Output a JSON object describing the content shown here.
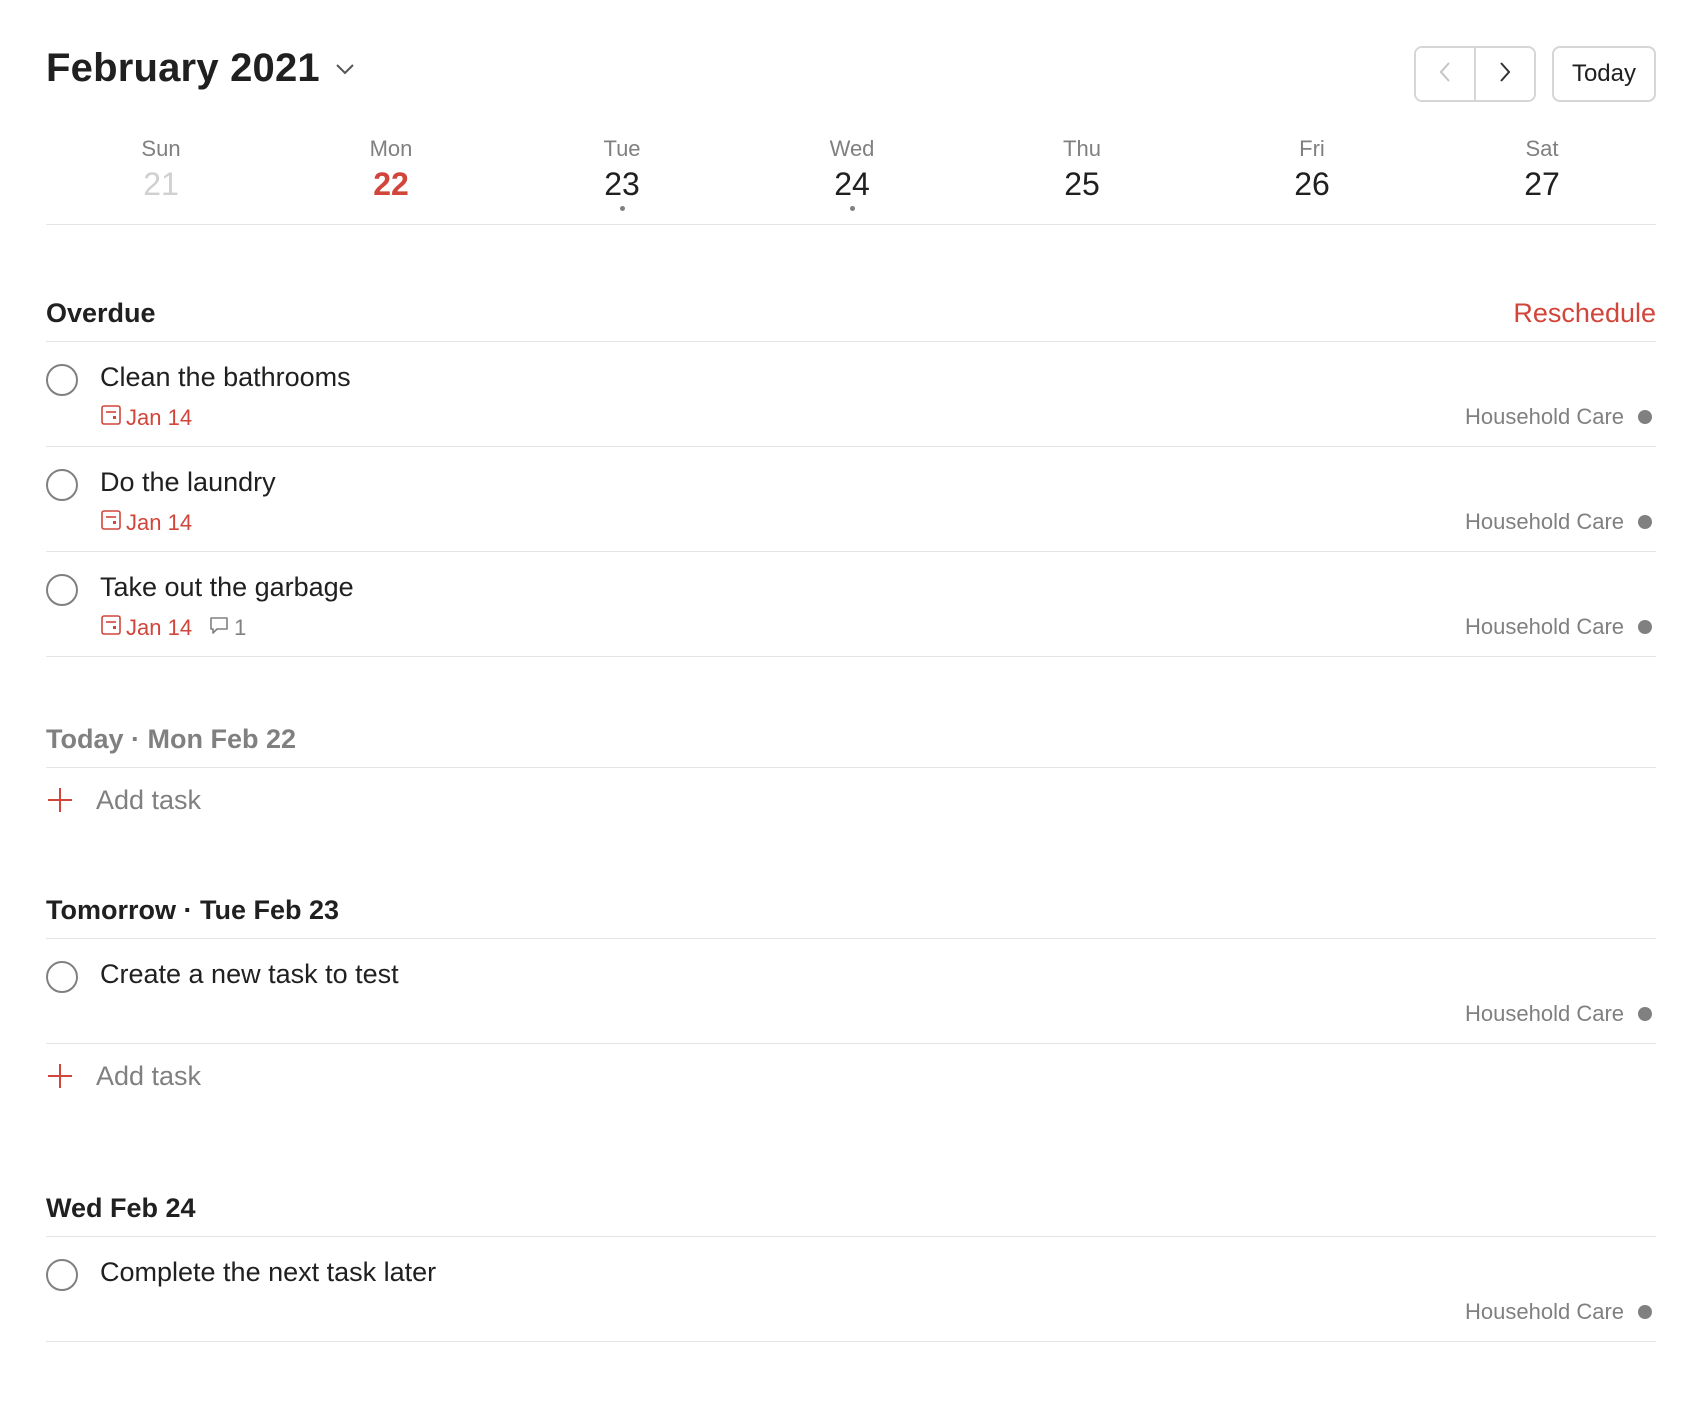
{
  "header": {
    "month_title": "February 2021",
    "prev_icon": "chevron-left-icon",
    "next_icon": "chevron-right-icon",
    "today_label": "Today"
  },
  "colors": {
    "accent": "#d1453b",
    "muted": "#808080",
    "text": "#202020",
    "divider": "#e4e4e4"
  },
  "week": [
    {
      "name": "Sun",
      "num": "21",
      "state": "past",
      "has_tasks": false
    },
    {
      "name": "Mon",
      "num": "22",
      "state": "today",
      "has_tasks": false
    },
    {
      "name": "Tue",
      "num": "23",
      "state": "future",
      "has_tasks": true
    },
    {
      "name": "Wed",
      "num": "24",
      "state": "future",
      "has_tasks": true
    },
    {
      "name": "Thu",
      "num": "25",
      "state": "future",
      "has_tasks": false
    },
    {
      "name": "Fri",
      "num": "26",
      "state": "future",
      "has_tasks": false
    },
    {
      "name": "Sat",
      "num": "27",
      "state": "future",
      "has_tasks": false
    }
  ],
  "overdue": {
    "title": "Overdue",
    "action_label": "Reschedule",
    "tasks": [
      {
        "title": "Clean the bathrooms",
        "due": "Jan 14",
        "project": "Household Care"
      },
      {
        "title": "Do the laundry",
        "due": "Jan 14",
        "project": "Household Care"
      },
      {
        "title": "Take out the garbage",
        "due": "Jan 14",
        "comments": "1",
        "project": "Household Care"
      }
    ]
  },
  "today": {
    "title": "Today · Mon Feb 22",
    "add_label": "Add task"
  },
  "tomorrow": {
    "title": "Tomorrow · Tue Feb 23",
    "tasks": [
      {
        "title": "Create a new task to test",
        "project": "Household Care"
      }
    ],
    "add_label": "Add task"
  },
  "wed": {
    "title": "Wed Feb 24",
    "tasks": [
      {
        "title": "Complete the next task later",
        "project": "Household Care"
      }
    ]
  }
}
